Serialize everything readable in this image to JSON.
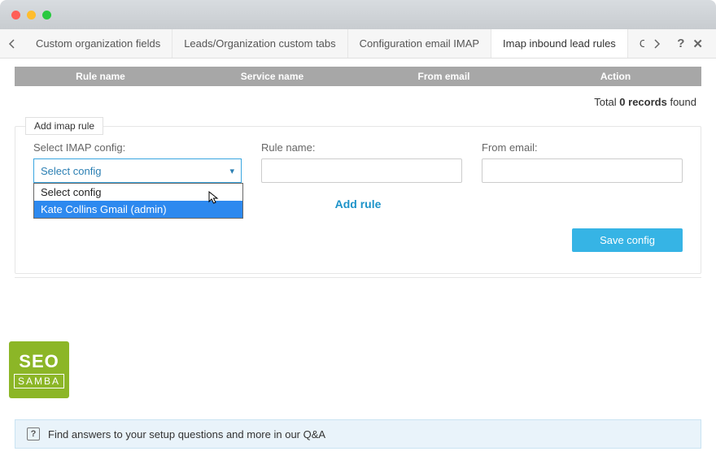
{
  "tabs": [
    "Custom organization fields",
    "Leads/Organization custom tabs",
    "Configuration email IMAP",
    "Imap inbound lead rules",
    "Cr"
  ],
  "active_tab_index": 3,
  "table": {
    "columns": [
      "Rule name",
      "Service name",
      "From email",
      "Action"
    ],
    "total_prefix": "Total ",
    "total_count": "0 records",
    "total_suffix": " found"
  },
  "panel": {
    "legend": "Add imap rule",
    "imap_label": "Select IMAP config:",
    "rule_name_label": "Rule name:",
    "from_email_label": "From email:",
    "select_value": "Select config",
    "options": [
      "Select config",
      "Kate Collins Gmail (admin)"
    ],
    "add_rule_label": "Add rule",
    "save_label": "Save config"
  },
  "logo": {
    "line1": "SEO",
    "line2": "SAMBA"
  },
  "qa_text": "Find answers to your setup questions and more in our Q&A"
}
